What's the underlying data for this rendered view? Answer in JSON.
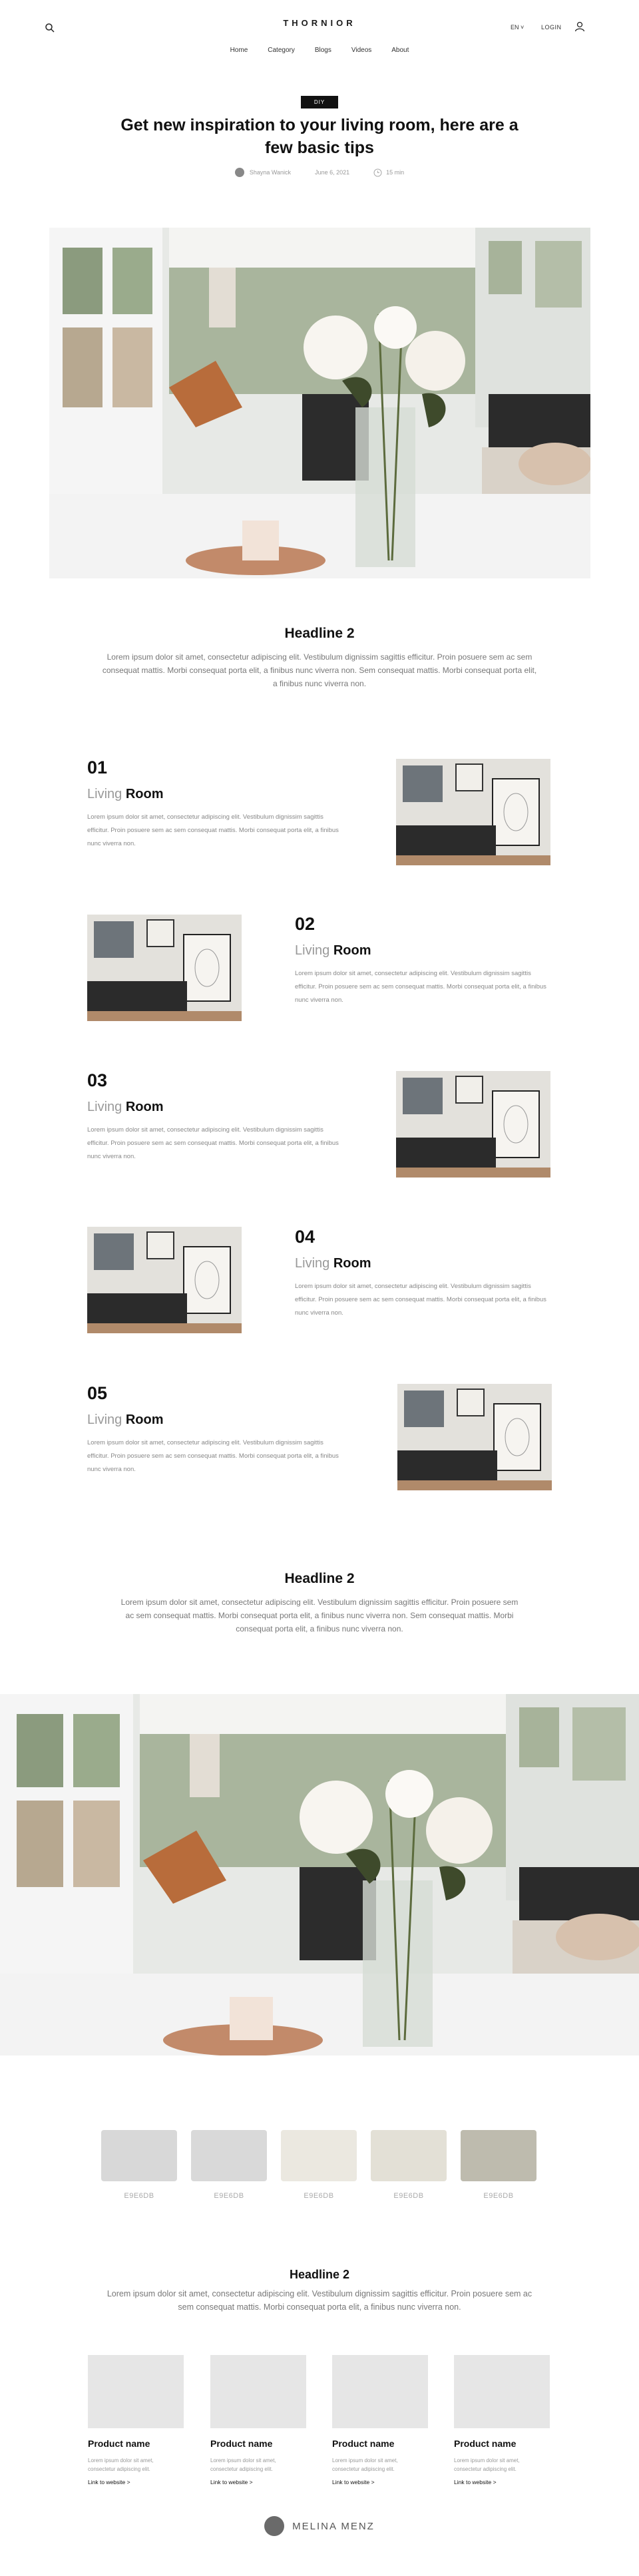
{
  "header": {
    "logo": "THORNIOR",
    "nav": [
      "Home",
      "Category",
      "Blogs",
      "Videos",
      "About"
    ],
    "lang": "EN ˅",
    "login": "LOGIN"
  },
  "hero": {
    "badge": "DIY",
    "title": "Get new inspiration to your living room, here are a few basic tips",
    "author": "Shayna Wanick",
    "date": "June 6, 2021",
    "read_time": "15 min"
  },
  "section1": {
    "headline": "Headline 2",
    "text": "Lorem ipsum dolor sit amet, consectetur adipiscing elit. Vestibulum dignissim sagittis efficitur. Proin posuere sem ac sem consequat mattis. Morbi consequat porta elit, a finibus nunc viverra non. Sem consequat mattis. Morbi consequat porta elit, a finibus nunc viverra non."
  },
  "features": [
    {
      "num": "01",
      "light": "Living",
      "bold": "Room",
      "text": "Lorem ipsum dolor sit amet, consectetur adipiscing elit. Vestibulum dignissim sagittis efficitur. Proin posuere sem ac sem consequat mattis. Morbi consequat porta elit, a finibus nunc viverra non."
    },
    {
      "num": "02",
      "light": "Living",
      "bold": "Room",
      "text": "Lorem ipsum dolor sit amet, consectetur adipiscing elit. Vestibulum dignissim sagittis efficitur. Proin posuere sem ac sem consequat mattis. Morbi consequat porta elit, a finibus nunc viverra non."
    },
    {
      "num": "03",
      "light": "Living",
      "bold": "Room",
      "text": "Lorem ipsum dolor sit amet, consectetur adipiscing elit. Vestibulum dignissim sagittis efficitur. Proin posuere sem ac sem consequat mattis. Morbi consequat porta elit, a finibus nunc viverra non."
    },
    {
      "num": "04",
      "light": "Living",
      "bold": "Room",
      "text": "Lorem ipsum dolor sit amet, consectetur adipiscing elit. Vestibulum dignissim sagittis efficitur. Proin posuere sem ac sem consequat mattis. Morbi consequat porta elit, a finibus nunc viverra non."
    },
    {
      "num": "05",
      "light": "Living",
      "bold": "Room",
      "text": "Lorem ipsum dolor sit amet, consectetur adipiscing elit. Vestibulum dignissim sagittis efficitur. Proin posuere sem ac sem consequat mattis. Morbi consequat porta elit, a finibus nunc viverra non."
    }
  ],
  "section2": {
    "headline": "Headline 2",
    "text": "Lorem ipsum dolor sit amet, consectetur adipiscing elit. Vestibulum dignissim sagittis efficitur. Proin posuere sem ac sem consequat mattis. Morbi consequat porta elit, a finibus nunc viverra non. Sem consequat mattis. Morbi consequat porta elit, a finibus nunc viverra non."
  },
  "swatches": [
    {
      "label": "E9E6DB",
      "color": "#d8d8d8"
    },
    {
      "label": "E9E6DB",
      "color": "#d9d9d9"
    },
    {
      "label": "E9E6DB",
      "color": "#ebe8e0"
    },
    {
      "label": "E9E6DB",
      "color": "#e3e0d6"
    },
    {
      "label": "E9E6DB",
      "color": "#bebbae"
    }
  ],
  "section3": {
    "headline": "Headline 2",
    "text": "Lorem ipsum dolor sit amet, consectetur adipiscing elit. Vestibulum dignissim sagittis efficitur. Proin posuere sem ac sem consequat mattis. Morbi consequat porta elit, a finibus nunc viverra non."
  },
  "products": [
    {
      "name": "Product name",
      "desc": "Lorem ipsum dolor sit amet, consectetur adipiscing elit.",
      "link": "Link to website >"
    },
    {
      "name": "Product name",
      "desc": "Lorem ipsum dolor sit amet, consectetur adipiscing elit.",
      "link": "Link to website >"
    },
    {
      "name": "Product name",
      "desc": "Lorem ipsum dolor sit amet, consectetur adipiscing elit.",
      "link": "Link to website >"
    },
    {
      "name": "Product name",
      "desc": "Lorem ipsum dolor sit amet, consectetur adipiscing elit.",
      "link": "Link to website >"
    }
  ],
  "footer": {
    "author": "MELINA MENZ"
  }
}
